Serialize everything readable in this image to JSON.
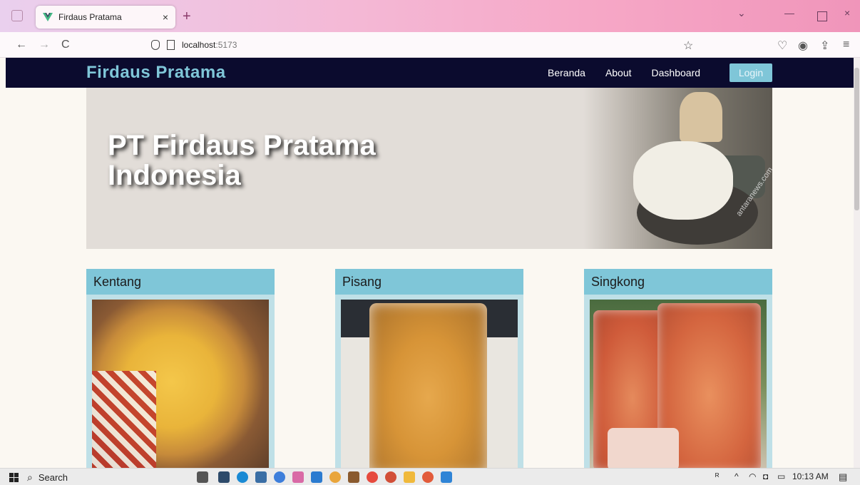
{
  "browser": {
    "tab_title": "Firdaus Pratama",
    "tab_close": "×",
    "new_tab": "+",
    "url_host": "localhost",
    "url_port": ":5173",
    "back": "←",
    "forward": "→",
    "reload": "C",
    "bookmark": "☆",
    "win_menu": "⌄",
    "win_min": "—",
    "win_close": "×",
    "ext_pocket": "♡",
    "ext_account": "◉",
    "ext_share": "⇪",
    "ext_menu": "≡"
  },
  "site": {
    "brand": "Firdaus Pratama",
    "nav": [
      "Beranda",
      "About",
      "Dashboard"
    ],
    "login": "Login",
    "hero_title_line1": "PT Firdaus Pratama",
    "hero_title_line2": "Indonesia",
    "hero_watermark": "antaranews.com",
    "products": [
      {
        "name": "Kentang"
      },
      {
        "name": "Pisang"
      },
      {
        "name": "Singkong"
      }
    ]
  },
  "taskbar": {
    "search_label": "Search",
    "time": "10:13 AM"
  },
  "colors": {
    "brand": "#7fc6d8",
    "header_bg": "#0b0b2e",
    "card_head": "#7fc6d8"
  }
}
